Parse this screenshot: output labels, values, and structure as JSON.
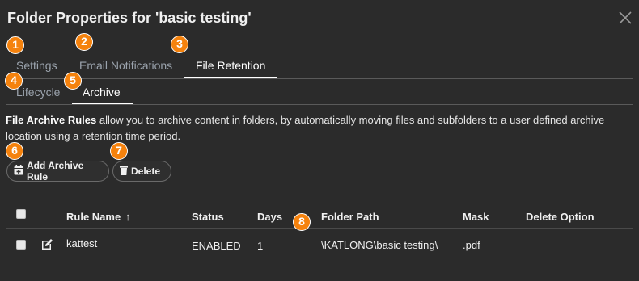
{
  "dialog": {
    "title": "Folder Properties for 'basic testing'"
  },
  "badges": [
    "1",
    "2",
    "3",
    "4",
    "5",
    "6",
    "7",
    "8"
  ],
  "tabs": [
    {
      "label": "Settings"
    },
    {
      "label": "Email Notifications"
    },
    {
      "label": "File Retention"
    }
  ],
  "subtabs": [
    {
      "label": "Lifecycle"
    },
    {
      "label": "Archive"
    }
  ],
  "description": {
    "bold": "File Archive Rules",
    "rest": " allow you to archive content in folders, by automatically moving files and subfolders to a user defined archive location using a retention time period."
  },
  "toolbar": {
    "add_label": "Add Archive Rule",
    "delete_label": "Delete"
  },
  "table": {
    "columns": [
      "Rule Name",
      "Status",
      "Days",
      "Folder Path",
      "Mask",
      "Delete Option"
    ],
    "sort_indicator": "↑",
    "rows": [
      {
        "rule_name": "kattest",
        "status": "ENABLED",
        "days": "1",
        "folder_path": "\\KATLONG\\basic testing\\",
        "mask": ".pdf",
        "delete_option": ""
      }
    ]
  },
  "colors": {
    "background": "#2b2b2b",
    "badge": "#f5820d",
    "active_tab": "#ffffff",
    "inactive_tab": "#9ba3ad"
  },
  "icons": [
    "close-icon",
    "calendar-plus-icon",
    "trash-icon",
    "edit-icon",
    "arrow-up-icon"
  ]
}
